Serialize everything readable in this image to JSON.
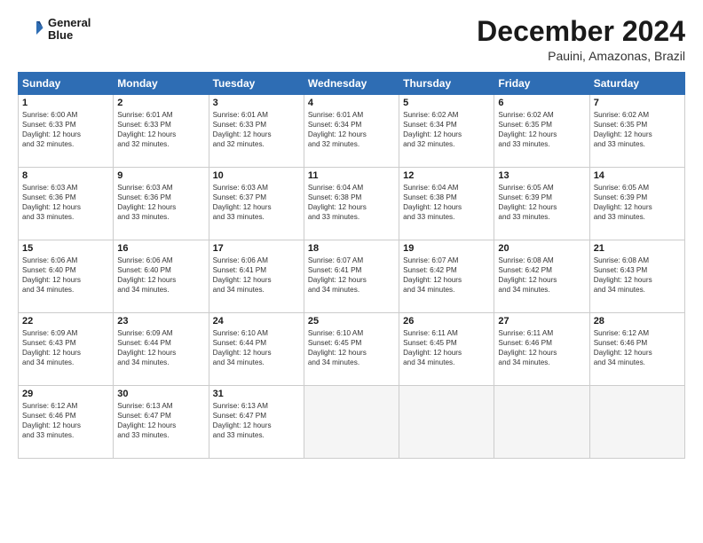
{
  "header": {
    "logo_line1": "General",
    "logo_line2": "Blue",
    "title": "December 2024",
    "subtitle": "Pauini, Amazonas, Brazil"
  },
  "days_of_week": [
    "Sunday",
    "Monday",
    "Tuesday",
    "Wednesday",
    "Thursday",
    "Friday",
    "Saturday"
  ],
  "weeks": [
    [
      {
        "day": "1",
        "info": "Sunrise: 6:00 AM\nSunset: 6:33 PM\nDaylight: 12 hours\nand 32 minutes."
      },
      {
        "day": "2",
        "info": "Sunrise: 6:01 AM\nSunset: 6:33 PM\nDaylight: 12 hours\nand 32 minutes."
      },
      {
        "day": "3",
        "info": "Sunrise: 6:01 AM\nSunset: 6:33 PM\nDaylight: 12 hours\nand 32 minutes."
      },
      {
        "day": "4",
        "info": "Sunrise: 6:01 AM\nSunset: 6:34 PM\nDaylight: 12 hours\nand 32 minutes."
      },
      {
        "day": "5",
        "info": "Sunrise: 6:02 AM\nSunset: 6:34 PM\nDaylight: 12 hours\nand 32 minutes."
      },
      {
        "day": "6",
        "info": "Sunrise: 6:02 AM\nSunset: 6:35 PM\nDaylight: 12 hours\nand 33 minutes."
      },
      {
        "day": "7",
        "info": "Sunrise: 6:02 AM\nSunset: 6:35 PM\nDaylight: 12 hours\nand 33 minutes."
      }
    ],
    [
      {
        "day": "8",
        "info": "Sunrise: 6:03 AM\nSunset: 6:36 PM\nDaylight: 12 hours\nand 33 minutes."
      },
      {
        "day": "9",
        "info": "Sunrise: 6:03 AM\nSunset: 6:36 PM\nDaylight: 12 hours\nand 33 minutes."
      },
      {
        "day": "10",
        "info": "Sunrise: 6:03 AM\nSunset: 6:37 PM\nDaylight: 12 hours\nand 33 minutes."
      },
      {
        "day": "11",
        "info": "Sunrise: 6:04 AM\nSunset: 6:38 PM\nDaylight: 12 hours\nand 33 minutes."
      },
      {
        "day": "12",
        "info": "Sunrise: 6:04 AM\nSunset: 6:38 PM\nDaylight: 12 hours\nand 33 minutes."
      },
      {
        "day": "13",
        "info": "Sunrise: 6:05 AM\nSunset: 6:39 PM\nDaylight: 12 hours\nand 33 minutes."
      },
      {
        "day": "14",
        "info": "Sunrise: 6:05 AM\nSunset: 6:39 PM\nDaylight: 12 hours\nand 33 minutes."
      }
    ],
    [
      {
        "day": "15",
        "info": "Sunrise: 6:06 AM\nSunset: 6:40 PM\nDaylight: 12 hours\nand 34 minutes."
      },
      {
        "day": "16",
        "info": "Sunrise: 6:06 AM\nSunset: 6:40 PM\nDaylight: 12 hours\nand 34 minutes."
      },
      {
        "day": "17",
        "info": "Sunrise: 6:06 AM\nSunset: 6:41 PM\nDaylight: 12 hours\nand 34 minutes."
      },
      {
        "day": "18",
        "info": "Sunrise: 6:07 AM\nSunset: 6:41 PM\nDaylight: 12 hours\nand 34 minutes."
      },
      {
        "day": "19",
        "info": "Sunrise: 6:07 AM\nSunset: 6:42 PM\nDaylight: 12 hours\nand 34 minutes."
      },
      {
        "day": "20",
        "info": "Sunrise: 6:08 AM\nSunset: 6:42 PM\nDaylight: 12 hours\nand 34 minutes."
      },
      {
        "day": "21",
        "info": "Sunrise: 6:08 AM\nSunset: 6:43 PM\nDaylight: 12 hours\nand 34 minutes."
      }
    ],
    [
      {
        "day": "22",
        "info": "Sunrise: 6:09 AM\nSunset: 6:43 PM\nDaylight: 12 hours\nand 34 minutes."
      },
      {
        "day": "23",
        "info": "Sunrise: 6:09 AM\nSunset: 6:44 PM\nDaylight: 12 hours\nand 34 minutes."
      },
      {
        "day": "24",
        "info": "Sunrise: 6:10 AM\nSunset: 6:44 PM\nDaylight: 12 hours\nand 34 minutes."
      },
      {
        "day": "25",
        "info": "Sunrise: 6:10 AM\nSunset: 6:45 PM\nDaylight: 12 hours\nand 34 minutes."
      },
      {
        "day": "26",
        "info": "Sunrise: 6:11 AM\nSunset: 6:45 PM\nDaylight: 12 hours\nand 34 minutes."
      },
      {
        "day": "27",
        "info": "Sunrise: 6:11 AM\nSunset: 6:46 PM\nDaylight: 12 hours\nand 34 minutes."
      },
      {
        "day": "28",
        "info": "Sunrise: 6:12 AM\nSunset: 6:46 PM\nDaylight: 12 hours\nand 34 minutes."
      }
    ],
    [
      {
        "day": "29",
        "info": "Sunrise: 6:12 AM\nSunset: 6:46 PM\nDaylight: 12 hours\nand 33 minutes."
      },
      {
        "day": "30",
        "info": "Sunrise: 6:13 AM\nSunset: 6:47 PM\nDaylight: 12 hours\nand 33 minutes."
      },
      {
        "day": "31",
        "info": "Sunrise: 6:13 AM\nSunset: 6:47 PM\nDaylight: 12 hours\nand 33 minutes."
      },
      {
        "day": "",
        "info": ""
      },
      {
        "day": "",
        "info": ""
      },
      {
        "day": "",
        "info": ""
      },
      {
        "day": "",
        "info": ""
      }
    ]
  ]
}
